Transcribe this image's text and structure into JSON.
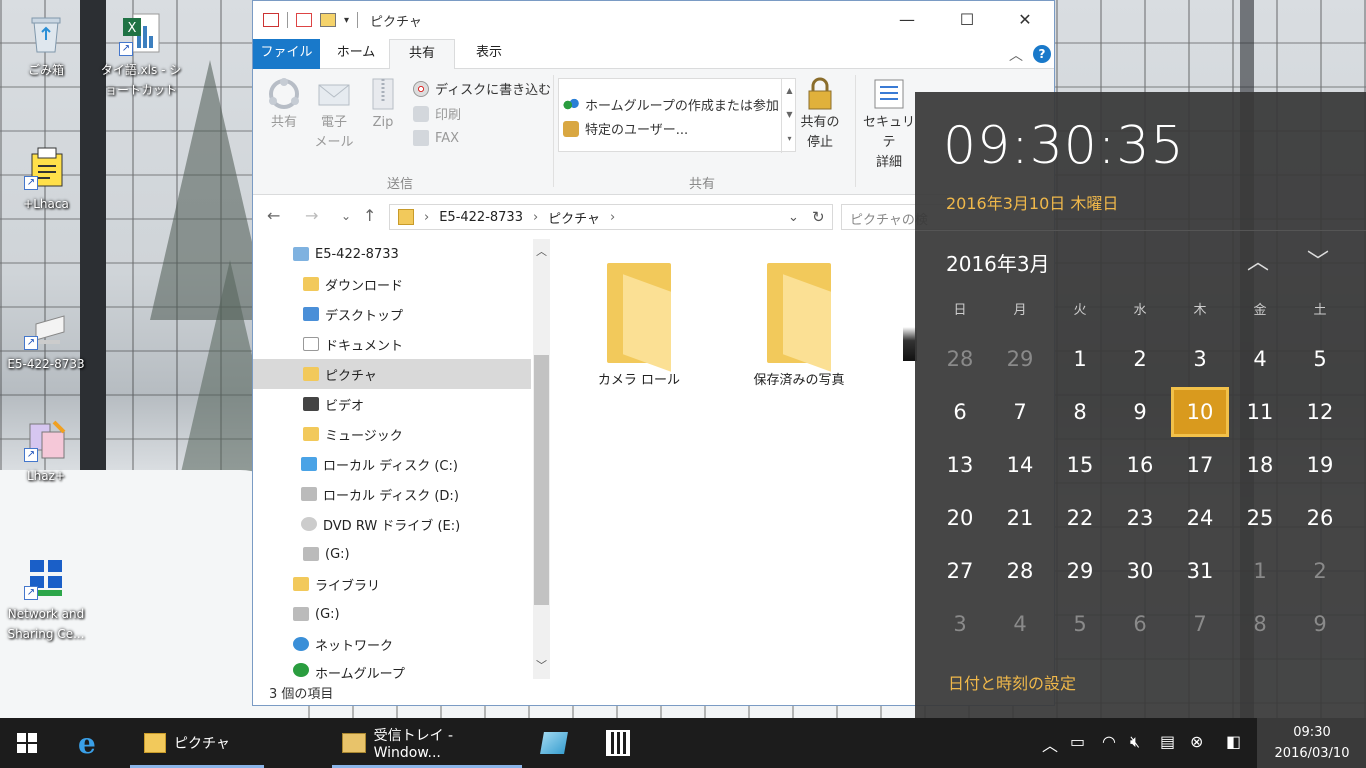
{
  "desktop": {
    "icons": [
      {
        "label": "ごみ箱",
        "icon": "recycle-bin-icon"
      },
      {
        "label": "タイ語.xls - ショートカット",
        "icon": "excel-file-icon"
      },
      {
        "label": "+Lhaca",
        "icon": "lhaca-app-icon"
      },
      {
        "label": "E5-422-8733",
        "icon": "computer-icon"
      },
      {
        "label": "Lhaz+",
        "icon": "lhaz-app-icon"
      },
      {
        "label": "Network and Sharing Ce...",
        "icon": "network-center-icon"
      }
    ]
  },
  "explorer": {
    "title": "ピクチャ",
    "tabs": [
      "ファイル",
      "ホーム",
      "共有",
      "表示"
    ],
    "active_tab": "共有",
    "ribbon": {
      "send": {
        "share": "共有",
        "email_1": "電子",
        "email_2": "メール",
        "zip": "Zip",
        "burn": "ディスクに書き込む",
        "print": "印刷",
        "fax": "FAX",
        "group_label": "送信"
      },
      "share": {
        "homegroup": "ホームグループの作成または参加",
        "specific_users": "特定のユーザー...",
        "stop_1": "共有の",
        "stop_2": "停止",
        "group_label": "共有"
      },
      "security_1": "セキュリテ",
      "security_2": "詳細"
    },
    "address": {
      "path": [
        "E5-422-8733",
        "ピクチャ"
      ],
      "search_placeholder": "ピクチャの検"
    },
    "nav_items": [
      {
        "label": "E5-422-8733",
        "icon": "computer-icon",
        "level": 0
      },
      {
        "label": "ダウンロード",
        "icon": "downloads-folder-icon",
        "level": 1
      },
      {
        "label": "デスクトップ",
        "icon": "desktop-folder-icon",
        "level": 1
      },
      {
        "label": "ドキュメント",
        "icon": "documents-folder-icon",
        "level": 1
      },
      {
        "label": "ピクチャ",
        "icon": "pictures-folder-icon",
        "level": 1,
        "selected": true
      },
      {
        "label": "ビデオ",
        "icon": "videos-folder-icon",
        "level": 1
      },
      {
        "label": "ミュージック",
        "icon": "music-folder-icon",
        "level": 1
      },
      {
        "label": "ローカル ディスク (C:)",
        "icon": "windows-drive-icon",
        "level": 1
      },
      {
        "label": "ローカル ディスク (D:)",
        "icon": "drive-icon",
        "level": 1
      },
      {
        "label": "DVD RW ドライブ (E:)",
        "icon": "dvd-drive-icon",
        "level": 1
      },
      {
        "label": " (G:)",
        "icon": "usb-drive-icon",
        "level": 1
      },
      {
        "label": "ライブラリ",
        "icon": "libraries-icon",
        "level": 0
      },
      {
        "label": " (G:)",
        "icon": "usb-drive-icon",
        "level": 0
      },
      {
        "label": "ネットワーク",
        "icon": "network-icon",
        "level": 0
      },
      {
        "label": "ホームグループ",
        "icon": "homegroup-icon",
        "level": 0
      }
    ],
    "items": [
      {
        "label": "カメラ ロール"
      },
      {
        "label": "保存済みの写真"
      }
    ],
    "status": "3 個の項目"
  },
  "clock": {
    "time": "09:30:35",
    "date": "2016年3月10日 木曜日",
    "month": "2016年3月",
    "weekdays": [
      "日",
      "月",
      "火",
      "水",
      "木",
      "金",
      "土"
    ],
    "days": [
      [
        "28",
        "29",
        "1",
        "2",
        "3",
        "4",
        "5"
      ],
      [
        "6",
        "7",
        "8",
        "9",
        "10",
        "11",
        "12"
      ],
      [
        "13",
        "14",
        "15",
        "16",
        "17",
        "18",
        "19"
      ],
      [
        "20",
        "21",
        "22",
        "23",
        "24",
        "25",
        "26"
      ],
      [
        "27",
        "28",
        "29",
        "30",
        "31",
        "1",
        "2"
      ],
      [
        "3",
        "4",
        "5",
        "6",
        "7",
        "8",
        "9"
      ]
    ],
    "today": "10",
    "settings_link": "日付と時刻の設定"
  },
  "taskbar": {
    "pictures_label": "ピクチャ",
    "mail_label": "受信トレイ - Window...",
    "time": "09:30",
    "date": "2016/03/10"
  },
  "colors": {
    "accent": "#1979ca",
    "clock_accent": "#f0b84a",
    "today_bg": "#d99a1e"
  }
}
